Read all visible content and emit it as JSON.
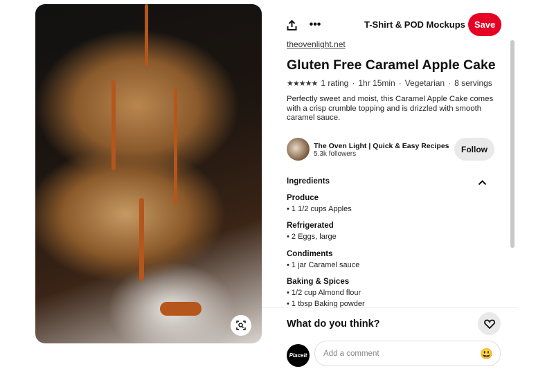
{
  "header": {
    "board": "T-Shirt & POD Mockups",
    "save_label": "Save"
  },
  "pin": {
    "source": "theovenlight.net",
    "title": "Gluten Free Caramel Apple Cake",
    "rating_stars": 5,
    "rating": "1 rating",
    "time": "1hr 15min",
    "diet": "Vegetarian",
    "servings": "8 servings",
    "description": "Perfectly sweet and moist, this Caramel Apple Cake comes with a crisp crumble topping and is drizzled with smooth caramel sauce."
  },
  "creator": {
    "name": "The Oven Light | Quick & Easy Recipes",
    "followers": "5.3k followers",
    "follow_label": "Follow"
  },
  "ingredients": {
    "heading": "Ingredients",
    "sections": [
      {
        "name": "Produce",
        "items": [
          "• 1 1/2 cups Apples"
        ]
      },
      {
        "name": "Refrigerated",
        "items": [
          "• 2 Eggs, large"
        ]
      },
      {
        "name": "Condiments",
        "items": [
          "• 1 jar Caramel sauce"
        ]
      },
      {
        "name": "Baking & Spices",
        "items": [
          "• 1/2 cup Almond flour",
          "• 1 tbsp Baking powder"
        ]
      }
    ]
  },
  "comments": {
    "prompt": "What do you think?",
    "placeholder": "Add a comment",
    "user_avatar": "Placeit"
  },
  "colors": {
    "save": "#e60023"
  }
}
